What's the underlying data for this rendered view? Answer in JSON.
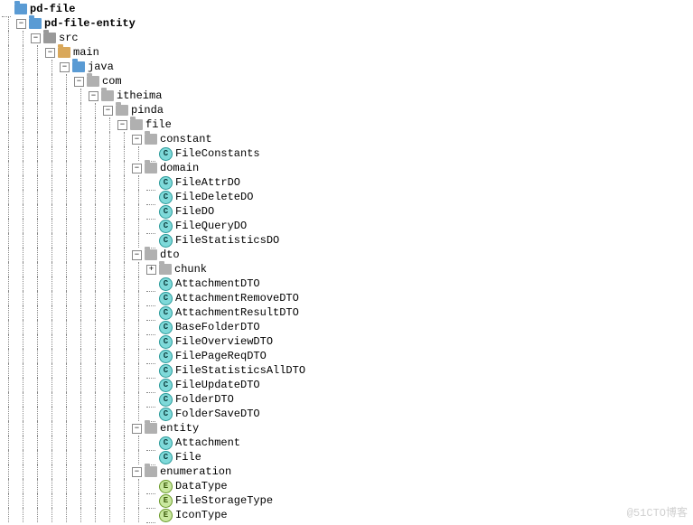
{
  "watermark": "@51CTO博客",
  "tree": [
    {
      "d": 0,
      "t": "root",
      "tog": "",
      "lbl": "pd-file",
      "bold": true
    },
    {
      "d": 1,
      "t": "root",
      "tog": "-",
      "lbl": "pd-file-entity",
      "bold": true
    },
    {
      "d": 2,
      "t": "src",
      "tog": "-",
      "lbl": "src"
    },
    {
      "d": 3,
      "t": "folder",
      "tog": "-",
      "lbl": "main"
    },
    {
      "d": 4,
      "t": "root",
      "tog": "-",
      "lbl": "java"
    },
    {
      "d": 5,
      "t": "pkg",
      "tog": "-",
      "lbl": "com"
    },
    {
      "d": 6,
      "t": "pkg",
      "tog": "-",
      "lbl": "itheima"
    },
    {
      "d": 7,
      "t": "pkg",
      "tog": "-",
      "lbl": "pinda"
    },
    {
      "d": 8,
      "t": "pkg",
      "tog": "-",
      "lbl": "file"
    },
    {
      "d": 9,
      "t": "pkg",
      "tog": "-",
      "lbl": "constant"
    },
    {
      "d": 10,
      "t": "c",
      "tog": "",
      "lbl": "FileConstants"
    },
    {
      "d": 9,
      "t": "pkg",
      "tog": "-",
      "lbl": "domain"
    },
    {
      "d": 10,
      "t": "c",
      "tog": "",
      "lbl": "FileAttrDO"
    },
    {
      "d": 10,
      "t": "c",
      "tog": "",
      "lbl": "FileDeleteDO"
    },
    {
      "d": 10,
      "t": "c",
      "tog": "",
      "lbl": "FileDO"
    },
    {
      "d": 10,
      "t": "c",
      "tog": "",
      "lbl": "FileQueryDO"
    },
    {
      "d": 10,
      "t": "c",
      "tog": "",
      "lbl": "FileStatisticsDO"
    },
    {
      "d": 9,
      "t": "pkg",
      "tog": "-",
      "lbl": "dto"
    },
    {
      "d": 10,
      "t": "pkg",
      "tog": "+",
      "lbl": "chunk"
    },
    {
      "d": 10,
      "t": "c",
      "tog": "",
      "lbl": "AttachmentDTO"
    },
    {
      "d": 10,
      "t": "c",
      "tog": "",
      "lbl": "AttachmentRemoveDTO"
    },
    {
      "d": 10,
      "t": "c",
      "tog": "",
      "lbl": "AttachmentResultDTO"
    },
    {
      "d": 10,
      "t": "c",
      "tog": "",
      "lbl": "BaseFolderDTO"
    },
    {
      "d": 10,
      "t": "c",
      "tog": "",
      "lbl": "FileOverviewDTO"
    },
    {
      "d": 10,
      "t": "c",
      "tog": "",
      "lbl": "FilePageReqDTO"
    },
    {
      "d": 10,
      "t": "c",
      "tog": "",
      "lbl": "FileStatisticsAllDTO"
    },
    {
      "d": 10,
      "t": "c",
      "tog": "",
      "lbl": "FileUpdateDTO"
    },
    {
      "d": 10,
      "t": "c",
      "tog": "",
      "lbl": "FolderDTO"
    },
    {
      "d": 10,
      "t": "c",
      "tog": "",
      "lbl": "FolderSaveDTO"
    },
    {
      "d": 9,
      "t": "pkg",
      "tog": "-",
      "lbl": "entity"
    },
    {
      "d": 10,
      "t": "c",
      "tog": "",
      "lbl": "Attachment"
    },
    {
      "d": 10,
      "t": "c",
      "tog": "",
      "lbl": "File"
    },
    {
      "d": 9,
      "t": "pkg",
      "tog": "-",
      "lbl": "enumeration"
    },
    {
      "d": 10,
      "t": "e",
      "tog": "",
      "lbl": "DataType"
    },
    {
      "d": 10,
      "t": "e",
      "tog": "",
      "lbl": "FileStorageType"
    },
    {
      "d": 10,
      "t": "e",
      "tog": "",
      "lbl": "IconType"
    }
  ]
}
